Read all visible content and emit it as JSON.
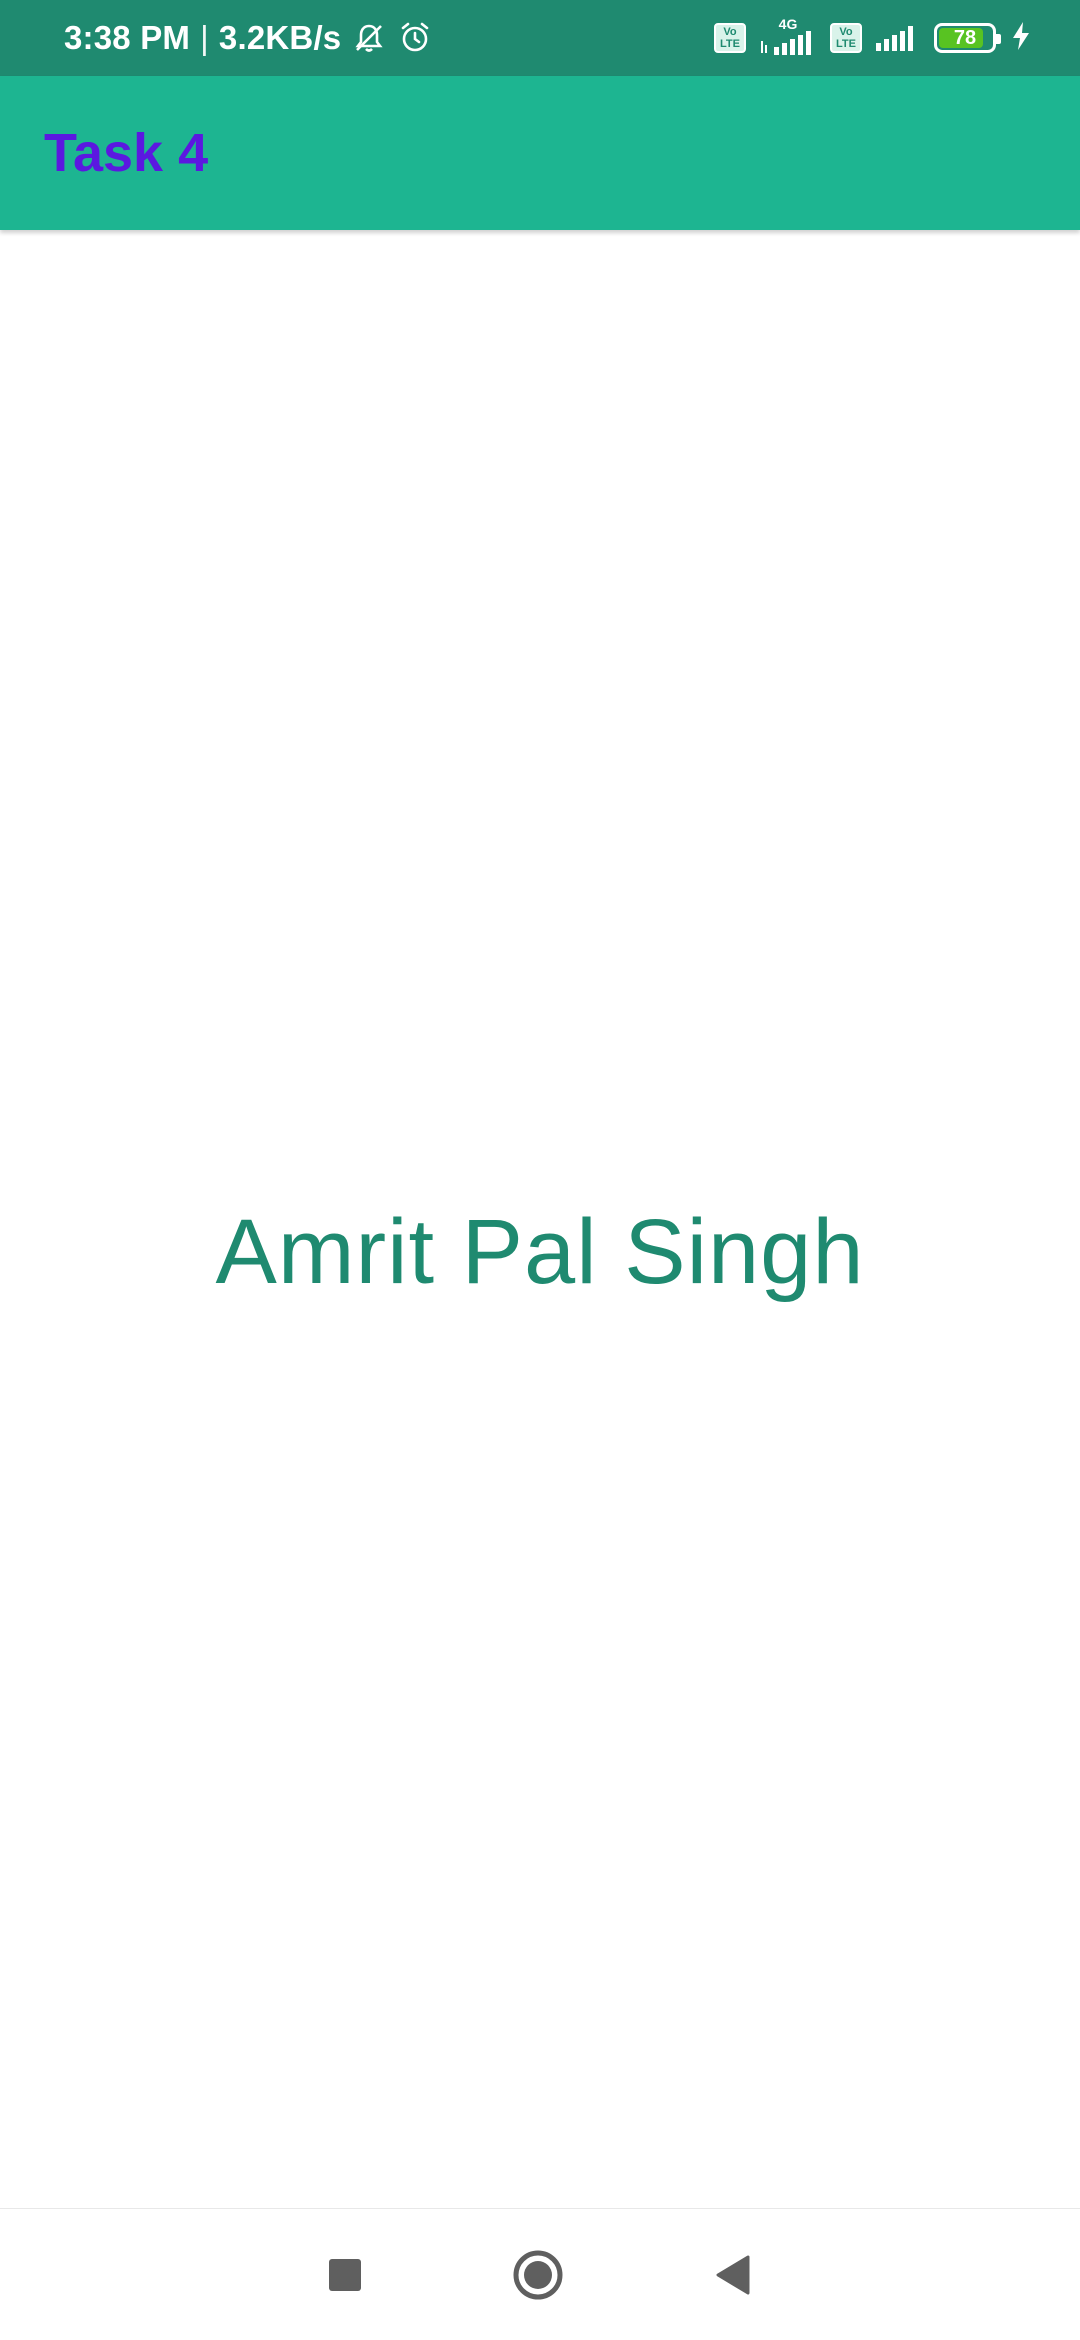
{
  "status_bar": {
    "time": "3:38 PM",
    "separator": "|",
    "speed": "3.2KB/s",
    "network_type": "4G",
    "volte_label": "Vo LTE",
    "battery_level": "78",
    "background_color": "#1f8a70",
    "icons": [
      "silent-icon",
      "alarm-icon",
      "volte-icon",
      "signal-icon",
      "battery-icon",
      "charging-icon"
    ]
  },
  "app_bar": {
    "title": "Task 4",
    "title_color": "#5b18e0",
    "background_color": "#1db591"
  },
  "main": {
    "name_text": "Amrit Pal Singh",
    "text_color": "#1f8a70"
  },
  "nav_bar": {
    "buttons": [
      "recents-button",
      "home-button",
      "back-button"
    ]
  }
}
